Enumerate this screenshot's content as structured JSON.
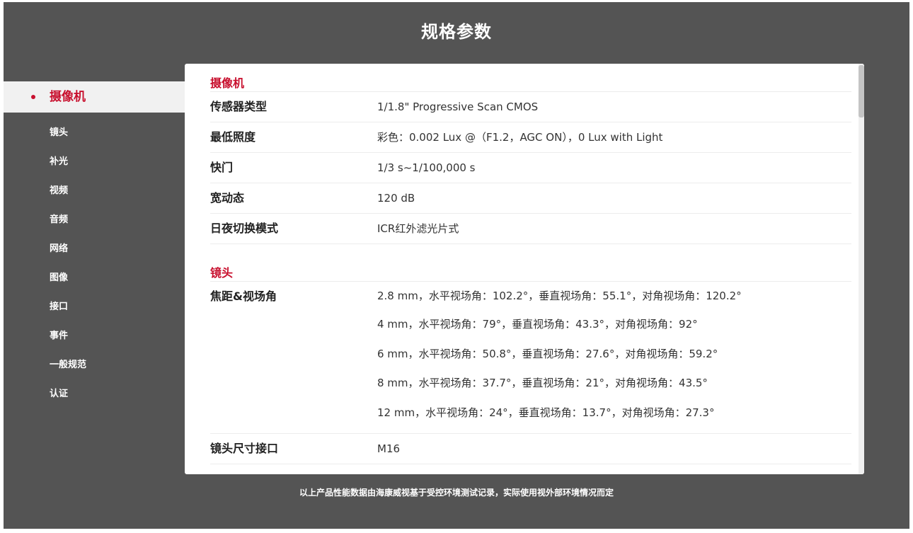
{
  "header": {
    "title": "规格参数"
  },
  "sidebar": {
    "items": [
      {
        "label": "摄像机",
        "active": true
      },
      {
        "label": "镜头"
      },
      {
        "label": "补光"
      },
      {
        "label": "视频"
      },
      {
        "label": "音频"
      },
      {
        "label": "网络"
      },
      {
        "label": "图像"
      },
      {
        "label": "接口"
      },
      {
        "label": "事件"
      },
      {
        "label": "一般规范"
      },
      {
        "label": "认证"
      }
    ]
  },
  "sections": [
    {
      "title": "摄像机",
      "rows": [
        {
          "label": "传感器类型",
          "values": [
            "1/1.8\" Progressive Scan CMOS"
          ]
        },
        {
          "label": "最低照度",
          "values": [
            "彩色：0.002 Lux @（F1.2，AGC ON），0 Lux with Light"
          ]
        },
        {
          "label": "快门",
          "values": [
            "1/3 s~1/100,000 s"
          ]
        },
        {
          "label": "宽动态",
          "values": [
            "120 dB"
          ]
        },
        {
          "label": "日夜切换模式",
          "values": [
            "ICR红外滤光片式"
          ]
        }
      ]
    },
    {
      "title": "镜头",
      "rows": [
        {
          "label": "焦距&视场角",
          "values": [
            "2.8 mm，水平视场角：102.2°，垂直视场角：55.1°，对角视场角：120.2°",
            "4 mm，水平视场角：79°，垂直视场角：43.3°，对角视场角：92°",
            "6 mm，水平视场角：50.8°，垂直视场角：27.6°，对角视场角：59.2°",
            "8 mm，水平视场角：37.7°，垂直视场角：21°，对角视场角：43.5°",
            "12 mm，水平视场角：24°，垂直视场角：13.7°，对角视场角：27.3°"
          ]
        },
        {
          "label": "镜头尺寸接口",
          "values": [
            "M16"
          ]
        }
      ]
    }
  ],
  "footer": {
    "note": "以上产品性能数据由海康威视基于受控环境测试记录，实际使用视外部环境情况而定"
  },
  "colors": {
    "accent": "#c8102e",
    "background": "#545454",
    "panel": "#ffffff"
  }
}
